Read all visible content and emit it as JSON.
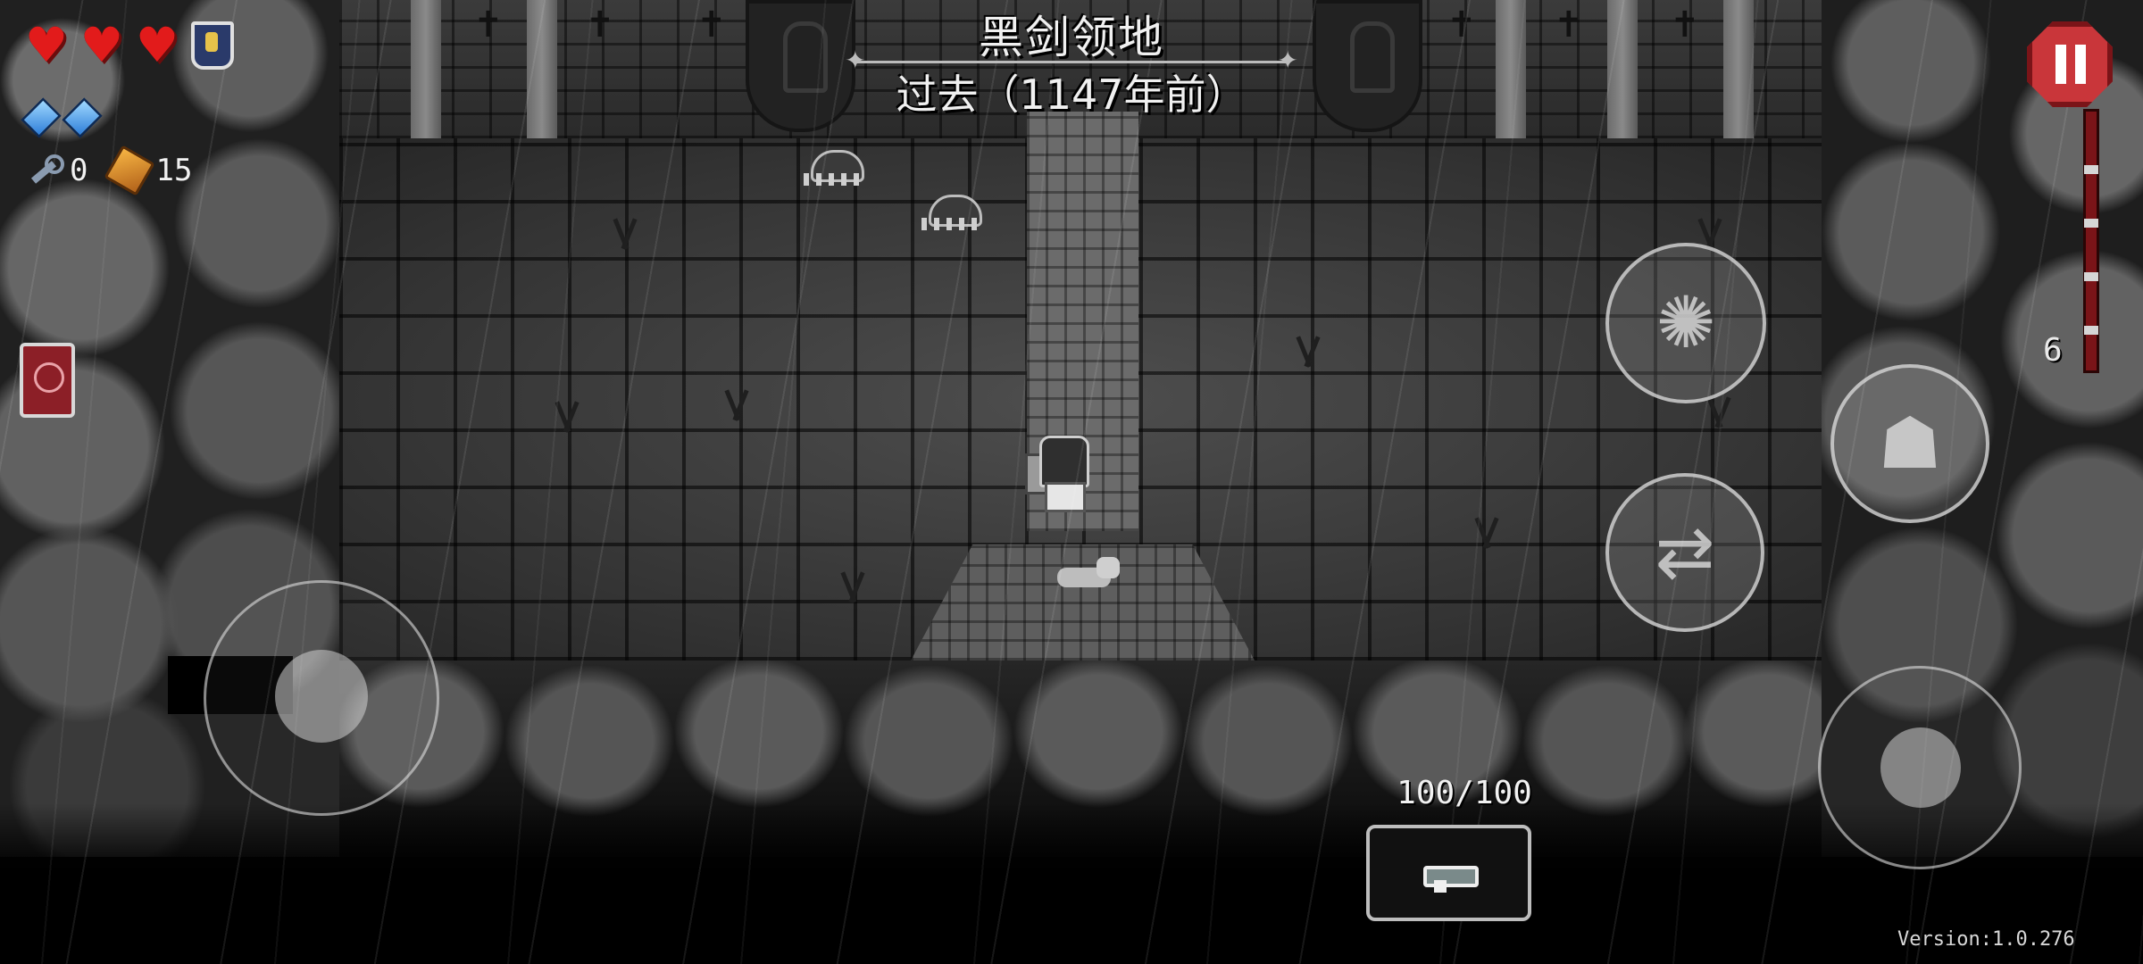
{
  "hud": {
    "health_hearts": 3,
    "armor_shields": 1,
    "energy_crystals": 2,
    "keys_count": "0",
    "coins_count": "15",
    "depth_count": "6"
  },
  "area": {
    "title": "黑剑领地",
    "subtitle": "过去（1147年前）"
  },
  "weapon": {
    "energy_readout": "100/100",
    "icon": "pistol-icon"
  },
  "icons": {
    "heart": "heart-icon",
    "shield": "shield-icon",
    "crystal": "crystal-icon",
    "key": "key-icon",
    "coin": "coin-icon",
    "book": "book-icon",
    "pause": "pause-icon",
    "skill_dash": "dash-skill-icon",
    "skill_special": "special-skill-icon",
    "skill_swap": "swap-weapon-icon"
  },
  "colors": {
    "heart": "#e21b1b",
    "pause_button": "#c9363a",
    "book": "#8c1f27"
  },
  "version": "Version:1.0.276"
}
